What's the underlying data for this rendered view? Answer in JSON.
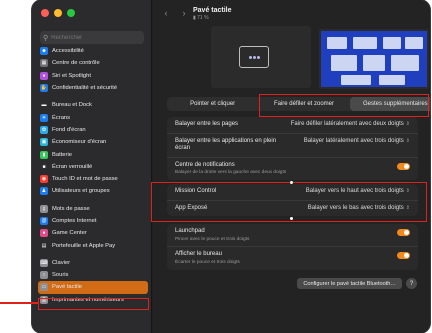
{
  "window": {
    "title": "Pavé tactile",
    "subtitle": "71 %"
  },
  "search": {
    "placeholder": "Rechercher"
  },
  "sidebar": {
    "items": [
      {
        "label": "Accessibilité",
        "icon": "accessibility-icon",
        "color": "#1a7cf0"
      },
      {
        "label": "Centre de contrôle",
        "icon": "control-center-icon",
        "color": "#6e6e73"
      },
      {
        "label": "Siri et Spotlight",
        "icon": "siri-icon",
        "color": "#b04fe0"
      },
      {
        "label": "Confidentialité et sécurité",
        "icon": "hand-icon",
        "color": "#1a7cf0"
      },
      {
        "label": "Bureau et Dock",
        "icon": "dock-icon",
        "color": "#2c2c2e"
      },
      {
        "label": "Écrans",
        "icon": "display-icon",
        "color": "#1a7cf0"
      },
      {
        "label": "Fond d'écran",
        "icon": "wallpaper-icon",
        "color": "#2aa8e8"
      },
      {
        "label": "Économiseur d'écran",
        "icon": "screensaver-icon",
        "color": "#25b6d9"
      },
      {
        "label": "Batterie",
        "icon": "battery-icon",
        "color": "#34c759"
      },
      {
        "label": "Écran verrouillé",
        "icon": "lock-screen-icon",
        "color": "#2c2c2e"
      },
      {
        "label": "Touch ID et mot de passe",
        "icon": "fingerprint-icon",
        "color": "#ff3b30"
      },
      {
        "label": "Utilisateurs et groupes",
        "icon": "users-icon",
        "color": "#1a7cf0"
      },
      {
        "label": "Mots de passe",
        "icon": "key-icon",
        "color": "#8e8e93"
      },
      {
        "label": "Comptes Internet",
        "icon": "at-icon",
        "color": "#1a7cf0"
      },
      {
        "label": "Game Center",
        "icon": "game-center-icon",
        "color": "#e24a8a"
      },
      {
        "label": "Portefeuille et Apple Pay",
        "icon": "wallet-icon",
        "color": "#2c2c2e"
      },
      {
        "label": "Clavier",
        "icon": "keyboard-icon",
        "color": "#8e8e93"
      },
      {
        "label": "Souris",
        "icon": "mouse-icon",
        "color": "#8e8e93"
      },
      {
        "label": "Pavé tactile",
        "icon": "trackpad-icon",
        "color": "#8e8e93",
        "selected": true
      },
      {
        "label": "Imprimantes et numériseurs",
        "icon": "printer-icon",
        "color": "#8e8e93"
      }
    ]
  },
  "tabs": [
    {
      "label": "Pointer et cliquer",
      "active": false
    },
    {
      "label": "Faire défiler et zoomer",
      "active": false
    },
    {
      "label": "Gestes supplémentaires",
      "active": true
    }
  ],
  "settings_group1": [
    {
      "label": "Balayer entre les pages",
      "value": "Faire défiler latéralement avec deux doigts"
    },
    {
      "label": "Balayer entre les applications en plein écran",
      "value": "Balayer latéralement avec trois doigts"
    },
    {
      "label": "Centre de notifications",
      "desc": "Balayer de la droite vers la gauche avec deux doigts",
      "toggle": true
    }
  ],
  "settings_group2": [
    {
      "label": "Mission Control",
      "value": "Balayer vers le haut avec trois doigts"
    },
    {
      "label": "App Exposé",
      "value": "Balayer vers le bas avec trois doigts"
    }
  ],
  "settings_group3": [
    {
      "label": "Launchpad",
      "desc": "Pincer avec le pouce et trois doigts",
      "toggle": true
    },
    {
      "label": "Afficher le bureau",
      "desc": "Écarter le pouce et trois doigts",
      "toggle": true
    }
  ],
  "buttons": {
    "bluetooth": "Configurer le pavé tactile Bluetooth…",
    "help": "?"
  },
  "colors": {
    "accent": "#f2891d",
    "selected_sidebar": "#d16b16",
    "annotation": "#e0201b"
  }
}
